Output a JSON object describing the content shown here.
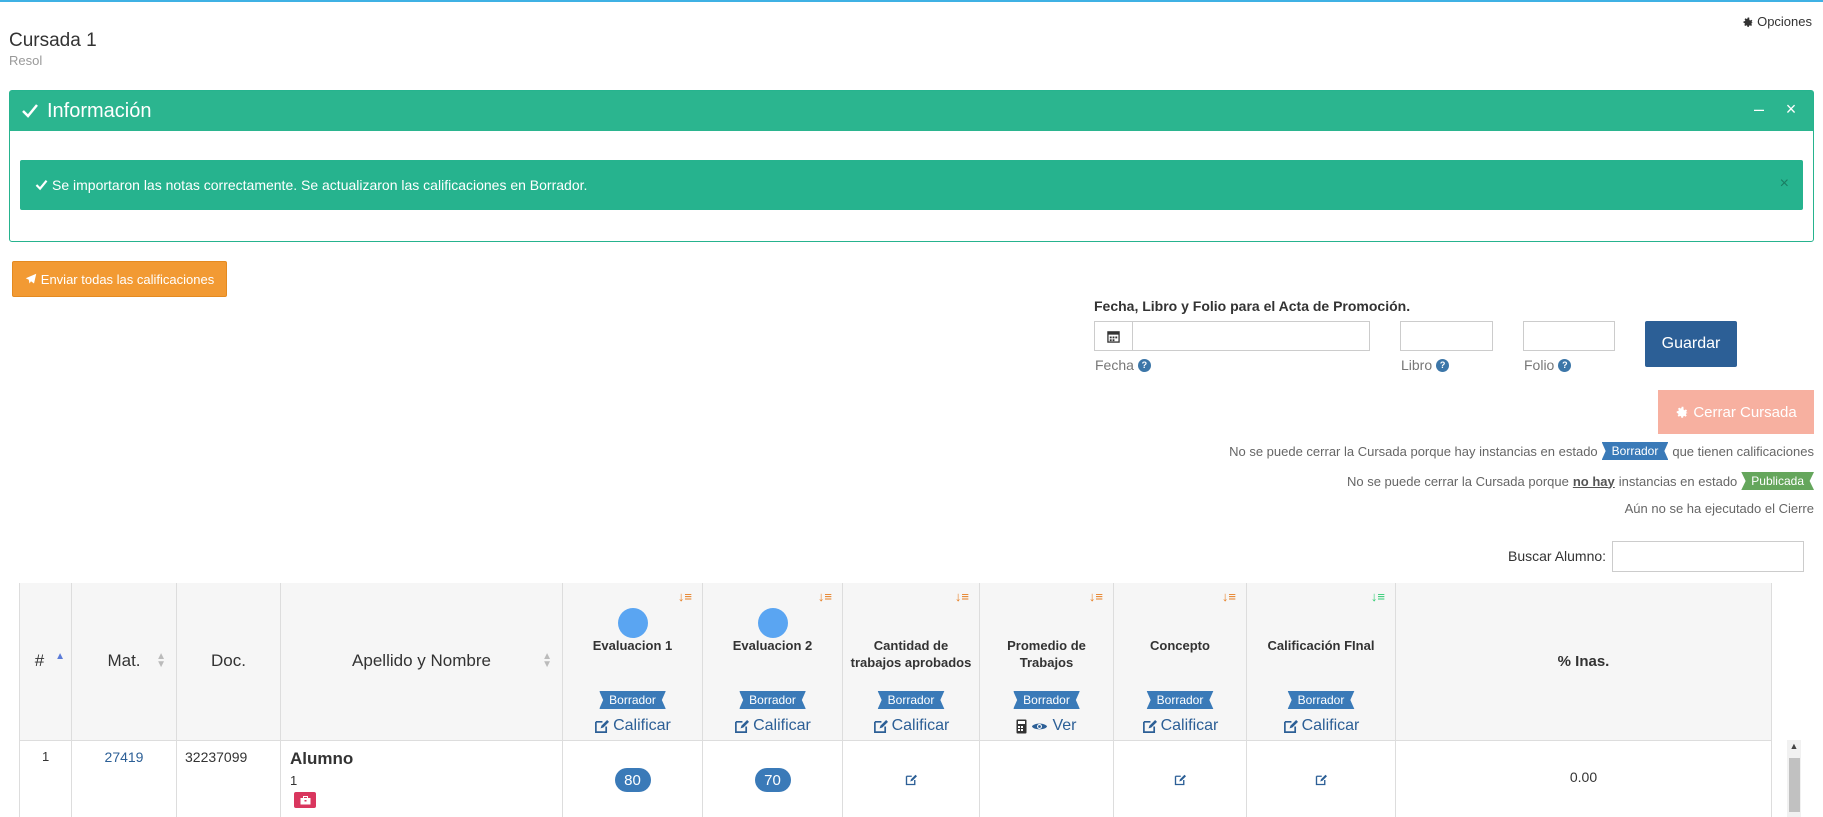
{
  "header": {
    "title": "Cursada 1",
    "subtitle": "Resol",
    "options_label": "Opciones"
  },
  "info_panel": {
    "title": "Información",
    "alert_text": "Se importaron las notas correctamente. Se actualizaron las calificaciones en Borrador.",
    "minimize_symbol": "–",
    "close_symbol": "×",
    "alert_close_symbol": "×"
  },
  "send_all_label": "Enviar todas las calificaciones",
  "acta": {
    "title": "Fecha, Libro y Folio para el Acta de Promoción.",
    "fecha_label": "Fecha",
    "libro_label": "Libro",
    "folio_label": "Folio",
    "help_symbol": "?",
    "fecha_value": "",
    "libro_value": "",
    "folio_value": "",
    "save_label": "Guardar"
  },
  "cerrar_label": "Cerrar Cursada",
  "notes": {
    "line1_prefix": "No se puede cerrar la Cursada porque hay instancias en estado",
    "line1_tag": "Borrador",
    "line1_suffix": "que tienen calificaciones",
    "line2_prefix": "No se puede cerrar la Cursada porque",
    "line2_emph": "no hay",
    "line2_mid": "instancias en estado",
    "line2_tag": "Publicada",
    "line3": "Aún no se ha ejecutado el Cierre"
  },
  "search": {
    "label": "Buscar Alumno:",
    "value": ""
  },
  "table": {
    "headers": {
      "num": "#",
      "mat": "Mat.",
      "doc": "Doc.",
      "name": "Apellido y Nombre",
      "ev1": "Evaluacion 1",
      "ev2": "Evaluacion 2",
      "cant_line1": "Cantidad de",
      "cant_line2": "trabajos aprobados",
      "prom_line1": "Promedio de",
      "prom_line2": "Trabajos",
      "concepto": "Concepto",
      "final": "Calificación FInal",
      "inas": "% Inas."
    },
    "status_tag": "Borrador",
    "calificar_label": "Calificar",
    "ver_label": "Ver",
    "rows": [
      {
        "num": "1",
        "mat": "27419",
        "doc": "32237099",
        "name": "Alumno",
        "name_sub": "1",
        "ev1": "80",
        "ev2": "70",
        "inas": "0.00"
      }
    ]
  },
  "colors": {
    "accent_green": "#2bb58f",
    "orange": "#f29a33",
    "primary_blue": "#2c5f96",
    "salmon": "#f7b0a0",
    "tag_blue": "#3a7ab8",
    "tag_green": "#65a65c"
  },
  "icons": {
    "options": "gear-icon",
    "info_title": "check-icon",
    "send": "paper-plane-icon",
    "date": "calendar-icon",
    "cerrar": "gear-icon",
    "sort": "sort-amount-icon",
    "calificar": "edit-icon",
    "ver": "eye-icon",
    "calculator": "calculator-icon",
    "student_badge": "briefcase-icon"
  }
}
